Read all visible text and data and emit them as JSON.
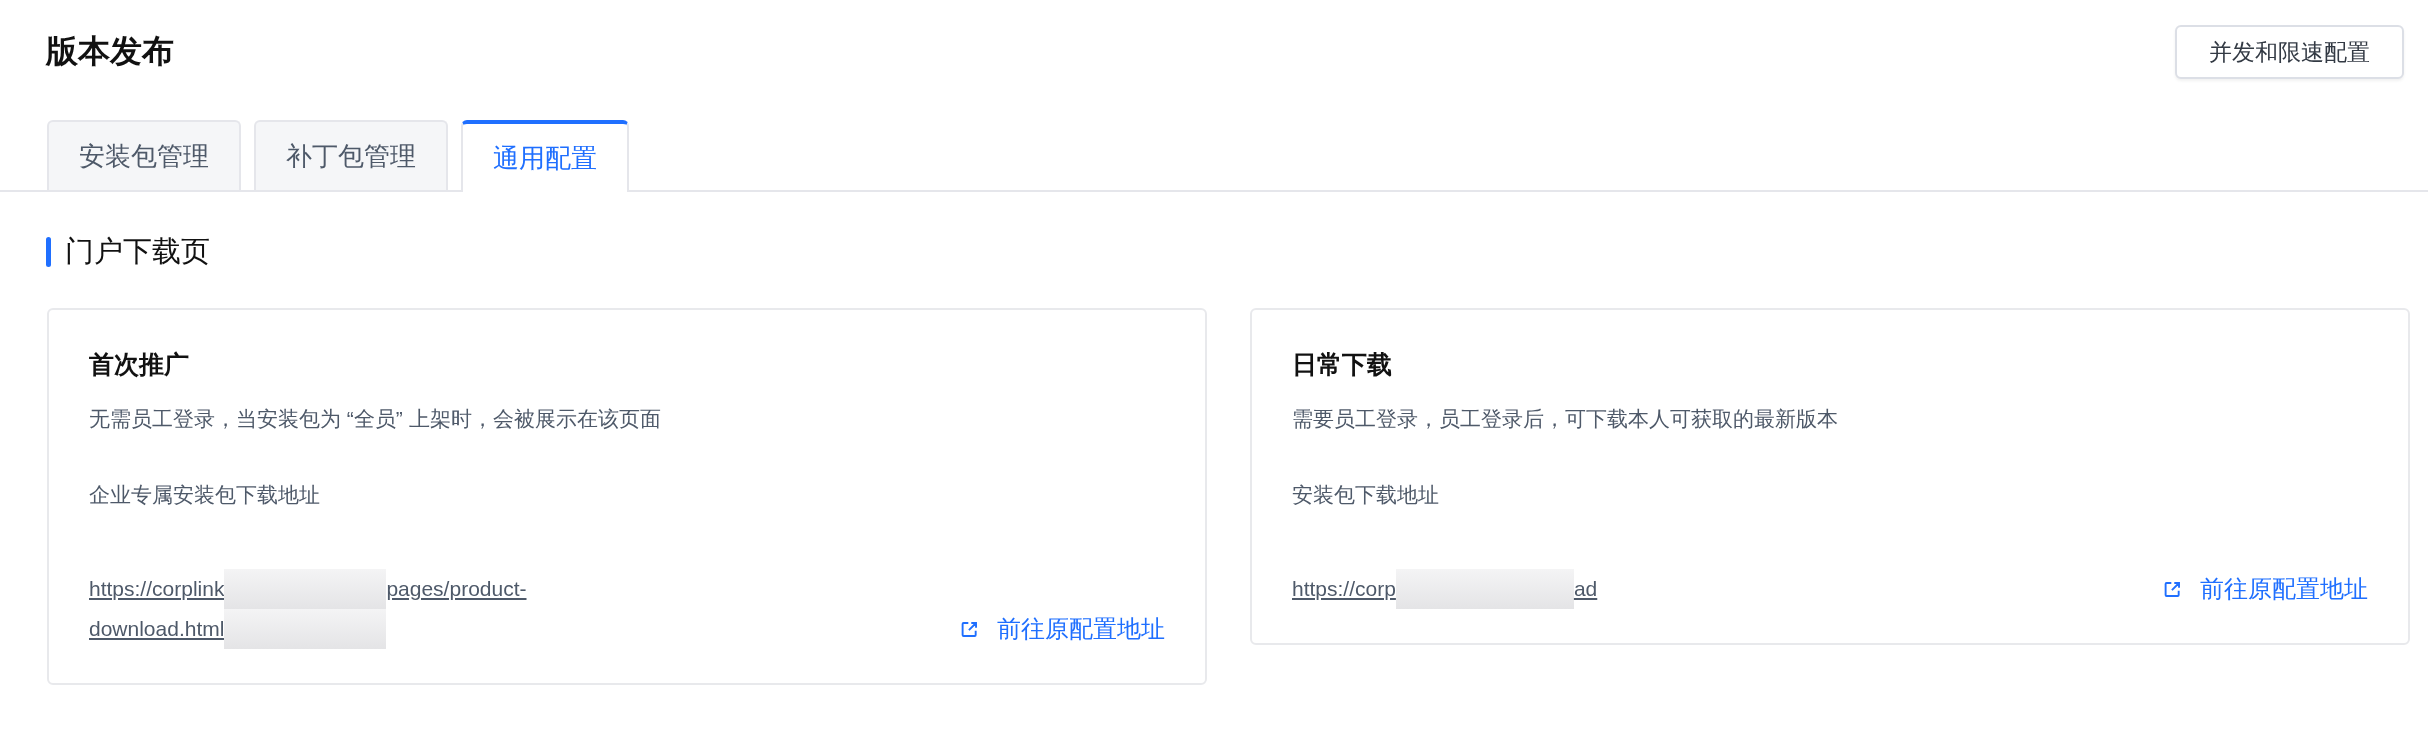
{
  "page": {
    "title": "版本发布",
    "action_button": "并发和限速配置"
  },
  "tabs": [
    {
      "label": "安装包管理",
      "selected": false
    },
    {
      "label": "补丁包管理",
      "selected": false
    },
    {
      "label": "通用配置",
      "selected": true
    }
  ],
  "section": {
    "title": "门户下载页"
  },
  "cards": [
    {
      "title": "首次推广",
      "description": "无需员工登录，当安装包为 “全员” 上架时，会被展示在该页面",
      "url_label": "企业专属安装包下载地址",
      "url_lines": [
        [
          {
            "kind": "text",
            "text": "https://corplink"
          },
          {
            "kind": "redacted"
          },
          {
            "kind": "text",
            "text": "pages/product-"
          }
        ],
        [
          {
            "kind": "text",
            "text": "download.html"
          },
          {
            "kind": "redacted"
          }
        ]
      ],
      "link": "前往原配置地址"
    },
    {
      "title": "日常下载",
      "description": "需要员工登录，员工登录后，可下载本人可获取的最新版本",
      "url_label": "安装包下载地址",
      "url_lines": [
        [
          {
            "kind": "text",
            "text": "https://corp"
          },
          {
            "kind": "redacted"
          },
          {
            "kind": "text",
            "text": "ad"
          }
        ]
      ],
      "link": "前往原配置地址"
    }
  ]
}
